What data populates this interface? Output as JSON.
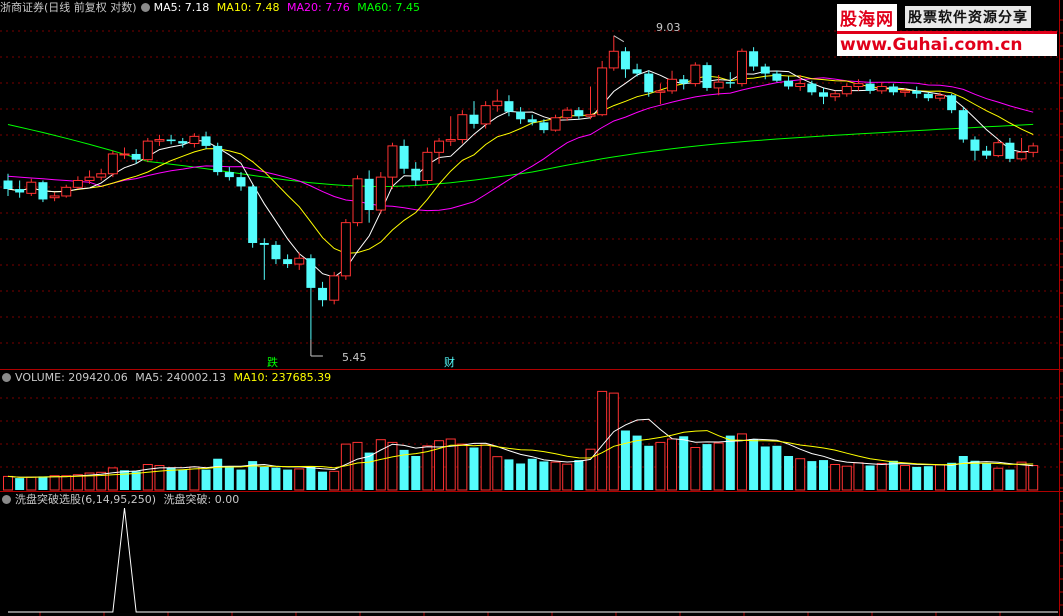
{
  "main_panel": {
    "title": "浙商证券(日线 前复权 对数)",
    "ma5": "MA5: 7.18",
    "ma10": "MA10: 7.48",
    "ma20": "MA20: 7.76",
    "ma60": "MA60: 7.45",
    "high_label": "9.03",
    "low_label": "5.45",
    "marker_die": "跌",
    "marker_cai": "财"
  },
  "volume_panel": {
    "title": "VOLUME: 209420.06",
    "ma5": "MA5: 240002.13",
    "ma10": "MA10: 237685.39"
  },
  "indicator_panel": {
    "title": "洗盘突破选股(6,14,95,250)",
    "value": "洗盘突破: 0.00"
  },
  "watermark": {
    "brand": "股海网",
    "slogan": "股票软件资源分享",
    "url": "www.Guhai.com.cn"
  },
  "colors": {
    "up": "#ff3232",
    "down": "#54fcfc",
    "ma5": "#ffffff",
    "ma10": "#ffff00",
    "ma20": "#ff00ff",
    "ma60": "#00ff00",
    "grid": "#7a0000",
    "border": "#b00000"
  },
  "chart_data": {
    "type": "candlestick",
    "price_range": [
      5.2,
      9.3
    ],
    "candles": [
      [
        7.1,
        7.0,
        7.18,
        6.92
      ],
      [
        7.0,
        6.96,
        7.1,
        6.9
      ],
      [
        6.95,
        7.08,
        7.12,
        6.92
      ],
      [
        7.08,
        6.88,
        7.1,
        6.85
      ],
      [
        6.9,
        6.92,
        6.96,
        6.86
      ],
      [
        6.92,
        7.02,
        7.05,
        6.9
      ],
      [
        7.02,
        7.1,
        7.15,
        7.0
      ],
      [
        7.1,
        7.14,
        7.22,
        7.06
      ],
      [
        7.14,
        7.18,
        7.24,
        7.1
      ],
      [
        7.18,
        7.42,
        7.46,
        7.14
      ],
      [
        7.42,
        7.42,
        7.5,
        7.36
      ],
      [
        7.42,
        7.35,
        7.48,
        7.3
      ],
      [
        7.35,
        7.58,
        7.62,
        7.32
      ],
      [
        7.58,
        7.6,
        7.66,
        7.52
      ],
      [
        7.6,
        7.58,
        7.66,
        7.54
      ],
      [
        7.58,
        7.55,
        7.62,
        7.5
      ],
      [
        7.55,
        7.64,
        7.68,
        7.5
      ],
      [
        7.64,
        7.52,
        7.7,
        7.48
      ],
      [
        7.52,
        7.2,
        7.56,
        7.16
      ],
      [
        7.2,
        7.14,
        7.26,
        7.1
      ],
      [
        7.14,
        7.03,
        7.2,
        6.98
      ],
      [
        7.03,
        6.4,
        7.05,
        6.35
      ],
      [
        6.4,
        6.38,
        6.45,
        6.02
      ],
      [
        6.38,
        6.23,
        6.42,
        6.18
      ],
      [
        6.23,
        6.18,
        6.28,
        6.14
      ],
      [
        6.18,
        6.24,
        6.3,
        6.12
      ],
      [
        6.24,
        5.94,
        6.28,
        5.45
      ],
      [
        5.94,
        5.82,
        6.0,
        5.76
      ],
      [
        5.82,
        6.06,
        6.1,
        5.78
      ],
      [
        6.06,
        6.62,
        6.66,
        6.02
      ],
      [
        6.62,
        7.12,
        7.16,
        6.58
      ],
      [
        7.12,
        6.76,
        7.22,
        6.62
      ],
      [
        6.76,
        7.14,
        7.2,
        6.72
      ],
      [
        7.14,
        7.52,
        7.56,
        7.0
      ],
      [
        7.52,
        7.24,
        7.6,
        7.18
      ],
      [
        7.24,
        7.1,
        7.32,
        7.04
      ],
      [
        7.1,
        7.44,
        7.5,
        7.06
      ],
      [
        7.44,
        7.58,
        7.62,
        7.3
      ],
      [
        7.58,
        7.6,
        7.9,
        7.52
      ],
      [
        7.6,
        7.92,
        7.98,
        7.55
      ],
      [
        7.92,
        7.8,
        8.1,
        7.74
      ],
      [
        7.8,
        8.04,
        8.1,
        7.74
      ],
      [
        8.04,
        8.1,
        8.26,
        7.96
      ],
      [
        8.1,
        7.96,
        8.18,
        7.9
      ],
      [
        7.96,
        7.86,
        8.02,
        7.8
      ],
      [
        7.86,
        7.82,
        7.92,
        7.78
      ],
      [
        7.82,
        7.72,
        7.86,
        7.68
      ],
      [
        7.72,
        7.88,
        7.92,
        7.7
      ],
      [
        7.88,
        7.98,
        8.02,
        7.84
      ],
      [
        7.98,
        7.9,
        8.02,
        7.86
      ],
      [
        7.9,
        7.92,
        8.3,
        7.86
      ],
      [
        7.92,
        8.56,
        8.66,
        7.9
      ],
      [
        8.56,
        8.8,
        9.03,
        8.52
      ],
      [
        8.8,
        8.54,
        8.86,
        8.42
      ],
      [
        8.54,
        8.48,
        8.62,
        8.44
      ],
      [
        8.48,
        8.22,
        8.52,
        8.16
      ],
      [
        8.22,
        8.24,
        8.34,
        8.06
      ],
      [
        8.24,
        8.4,
        8.52,
        8.2
      ],
      [
        8.4,
        8.34,
        8.46,
        8.26
      ],
      [
        8.34,
        8.6,
        8.64,
        8.3
      ],
      [
        8.6,
        8.28,
        8.64,
        8.24
      ],
      [
        8.28,
        8.36,
        8.46,
        8.18
      ],
      [
        8.36,
        8.34,
        8.5,
        8.28
      ],
      [
        8.34,
        8.8,
        8.84,
        8.3
      ],
      [
        8.8,
        8.58,
        8.86,
        8.52
      ],
      [
        8.58,
        8.48,
        8.62,
        8.4
      ],
      [
        8.48,
        8.38,
        8.52,
        8.36
      ],
      [
        8.38,
        8.3,
        8.44,
        8.26
      ],
      [
        8.3,
        8.34,
        8.46,
        8.24
      ],
      [
        8.34,
        8.22,
        8.38,
        8.18
      ],
      [
        8.22,
        8.16,
        8.28,
        8.06
      ],
      [
        8.16,
        8.2,
        8.24,
        8.1
      ],
      [
        8.2,
        8.3,
        8.34,
        8.16
      ],
      [
        8.3,
        8.34,
        8.4,
        8.24
      ],
      [
        8.34,
        8.24,
        8.4,
        8.2
      ],
      [
        8.24,
        8.3,
        8.36,
        8.2
      ],
      [
        8.3,
        8.22,
        8.34,
        8.18
      ],
      [
        8.22,
        8.24,
        8.28,
        8.16
      ],
      [
        8.24,
        8.2,
        8.3,
        8.14
      ],
      [
        8.2,
        8.14,
        8.22,
        8.1
      ],
      [
        8.14,
        8.18,
        8.22,
        8.1
      ],
      [
        8.18,
        7.98,
        8.2,
        7.94
      ],
      [
        7.98,
        7.6,
        8.02,
        7.56
      ],
      [
        7.6,
        7.46,
        7.64,
        7.34
      ],
      [
        7.46,
        7.4,
        7.52,
        7.36
      ],
      [
        7.4,
        7.56,
        7.6,
        7.38
      ],
      [
        7.56,
        7.36,
        7.62,
        7.32
      ],
      [
        7.36,
        7.44,
        7.62,
        7.34
      ],
      [
        7.44,
        7.52,
        7.56,
        7.38
      ]
    ],
    "volume": [
      40,
      35,
      38,
      40,
      42,
      42,
      45,
      50,
      52,
      65,
      58,
      55,
      75,
      72,
      66,
      60,
      68,
      60,
      92,
      70,
      60,
      85,
      68,
      66,
      60,
      62,
      70,
      54,
      55,
      135,
      140,
      110,
      148,
      140,
      118,
      100,
      130,
      145,
      150,
      135,
      125,
      132,
      98,
      90,
      78,
      92,
      84,
      82,
      76,
      88,
      120,
      290,
      285,
      175,
      160,
      130,
      140,
      150,
      158,
      125,
      135,
      138,
      160,
      165,
      150,
      128,
      130,
      100,
      92,
      85,
      88,
      75,
      70,
      80,
      72,
      78,
      86,
      72,
      68,
      70,
      74,
      80,
      100,
      86,
      78,
      64,
      60,
      82,
      72
    ],
    "volume_up": [
      true,
      false,
      true,
      false,
      true,
      true,
      true,
      true,
      true,
      true,
      false,
      false,
      true,
      true,
      false,
      false,
      true,
      false,
      false,
      false,
      false,
      false,
      false,
      false,
      false,
      true,
      false,
      false,
      true,
      true,
      true,
      false,
      true,
      true,
      false,
      false,
      true,
      true,
      true,
      true,
      false,
      true,
      true,
      false,
      false,
      false,
      false,
      true,
      true,
      false,
      true,
      true,
      true,
      false,
      false,
      false,
      true,
      true,
      false,
      true,
      false,
      true,
      false,
      true,
      false,
      false,
      false,
      false,
      true,
      false,
      false,
      true,
      true,
      true,
      false,
      true,
      false,
      true,
      false,
      false,
      true,
      false,
      false,
      false,
      false,
      true,
      false,
      true,
      true
    ],
    "volume_range": [
      0,
      300
    ],
    "indicator": {
      "values_nonzero_index": 10,
      "range": [
        0,
        1
      ]
    }
  }
}
